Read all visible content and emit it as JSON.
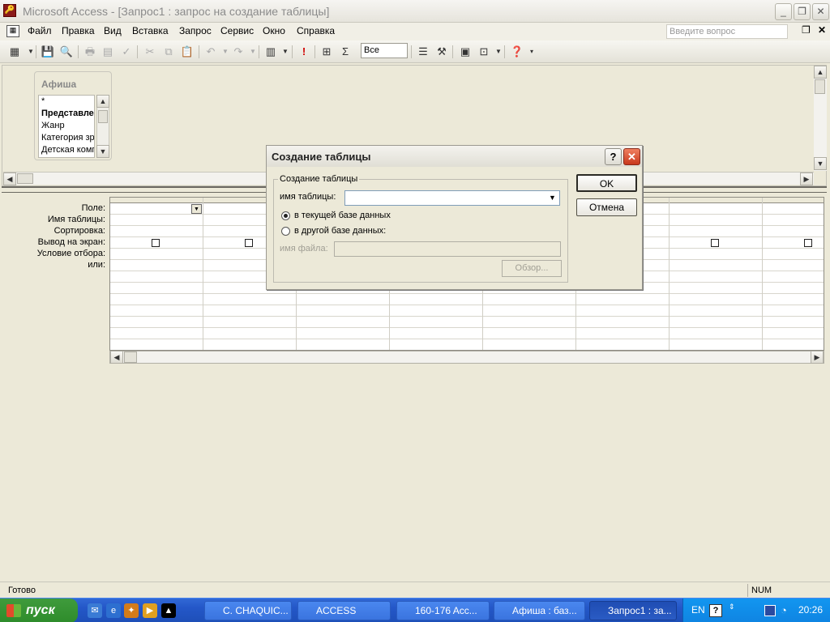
{
  "window": {
    "title": "Microsoft Access - [Запрос1 : запрос на создание таблицы]",
    "minimize": "_",
    "restore": "❐",
    "close": "✕"
  },
  "menubar": {
    "items": [
      "Файл",
      "Правка",
      "Вид",
      "Вставка",
      "Запрос",
      "Сервис",
      "Окно",
      "Справка"
    ],
    "ask_placeholder": "Введите вопрос"
  },
  "toolbar": {
    "top_values": "Все"
  },
  "design": {
    "table": {
      "title": "Афиша",
      "fields": [
        "*",
        "Представления",
        "Жанр",
        "Категория зрителей",
        "Детская компания"
      ]
    },
    "grid_labels": [
      "Поле:",
      "Имя таблицы:",
      "Сортировка:",
      "Вывод на экран:",
      "Условие отбора:",
      "или:"
    ]
  },
  "dialog": {
    "title": "Создание таблицы",
    "help": "?",
    "close": "✕",
    "group_title": "Создание таблицы",
    "table_name_label": "имя таблицы:",
    "table_name_value": "",
    "radio_current": "в текущей базе данных",
    "radio_other": "в другой базе данных:",
    "file_name_label": "имя файла:",
    "browse": "Обзор...",
    "ok": "OK",
    "cancel": "Отмена"
  },
  "status": {
    "text": "Готово",
    "num": "NUM"
  },
  "taskbar": {
    "start": "пуск",
    "tasks": [
      "C. CHAQUIC...",
      "ACCESS",
      "160-176 Acc...",
      "Афиша : баз...",
      "Запрос1 : за..."
    ],
    "lang": "EN",
    "clock": "20:26"
  }
}
